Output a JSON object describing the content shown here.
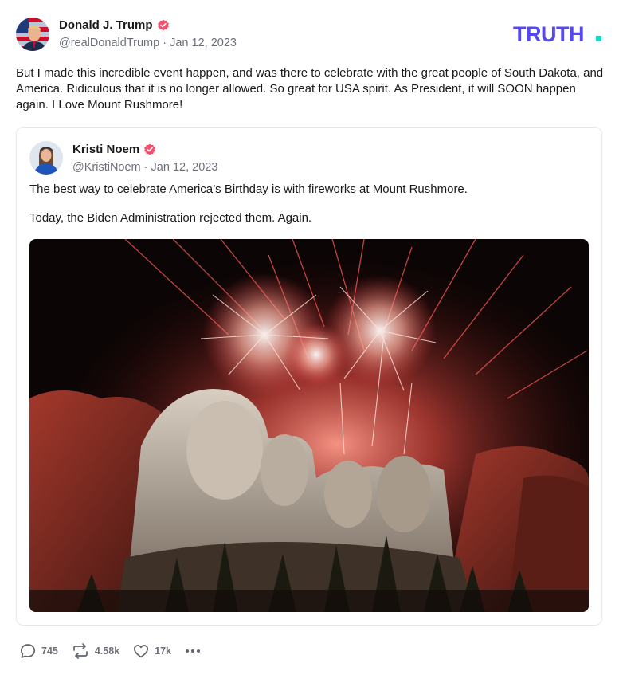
{
  "author": {
    "name": "Donald J. Trump",
    "handle": "@realDonaldTrump",
    "date": "Jan 12, 2023",
    "separator": "·"
  },
  "brand": {
    "logo_text": "TRUTH.",
    "color": "#5448ee",
    "dot_color": "#17d6c8"
  },
  "post": {
    "text": "But I made this incredible event happen, and was there to celebrate with the great people of South Dakota, and America. Ridiculous that it is no longer allowed. So great for USA spirit. As President, it will SOON happen again. I Love Mount Rushmore!"
  },
  "quote": {
    "name": "Kristi Noem",
    "handle": "@KristiNoem",
    "date": "Jan 12, 2023",
    "separator": "·",
    "line1": "The best way to celebrate America’s Birthday is with fireworks at Mount Rushmore.",
    "line2": "Today, the Biden Administration rejected them. Again."
  },
  "actions": {
    "replies": "745",
    "retruths": "4.58k",
    "likes": "17k"
  },
  "icons": [
    "verified-badge-icon",
    "reply-icon",
    "retruth-icon",
    "like-icon",
    "more-icon"
  ],
  "colors": {
    "verified": "#f0506e",
    "muted": "#6b6f78",
    "border": "#e6e7eb"
  }
}
